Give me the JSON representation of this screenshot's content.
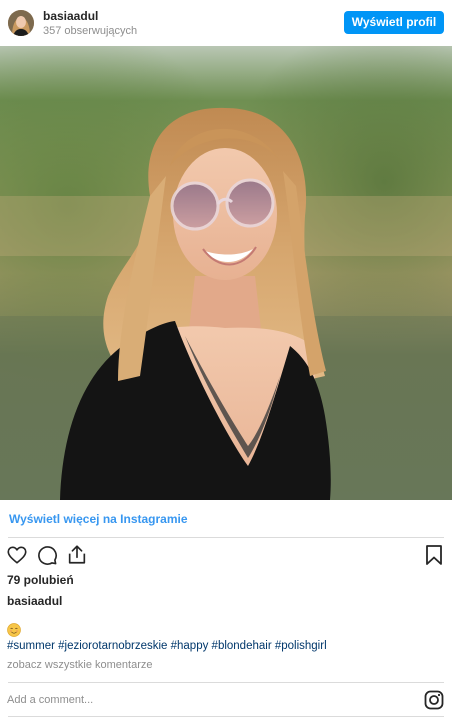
{
  "header": {
    "username": "basiaadul",
    "followers": "357 obserwujących",
    "view_profile_label": "Wyświetl profil"
  },
  "post": {
    "view_more_label": "Wyświetl więcej na Instagramie",
    "likes": "79 polubień",
    "author": "basiaadul",
    "caption_emoji": "blush-emoji",
    "hashtags": "#summer #jeziorotarnobrzeskie #happy #blondehair #polishgirl",
    "comments_link": "zobacz wszystkie komentarze",
    "add_comment_placeholder": "Add a comment..."
  },
  "icons": {
    "like": "heart-icon",
    "comment": "comment-icon",
    "share": "share-icon",
    "save": "bookmark-icon",
    "instagram": "instagram-icon"
  },
  "colors": {
    "accent": "#0095f6",
    "link": "#3897f0",
    "hashtag": "#00376b",
    "muted": "#8e8e8e",
    "divider": "#dbdbdb"
  }
}
